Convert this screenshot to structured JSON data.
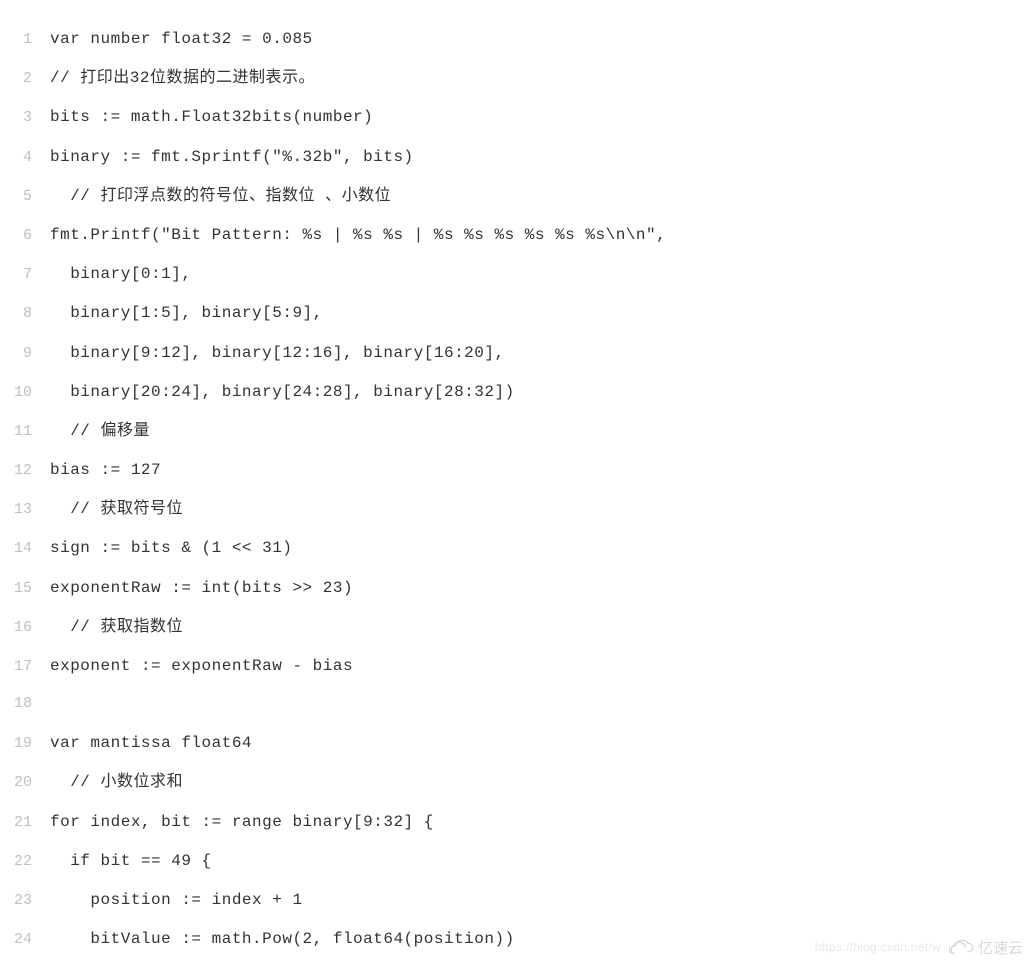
{
  "code": {
    "lines": [
      {
        "num": "1",
        "text": "var number float32 = 0.085"
      },
      {
        "num": "2",
        "text": "// 打印出32位数据的二进制表示。"
      },
      {
        "num": "3",
        "text": "bits := math.Float32bits(number)"
      },
      {
        "num": "4",
        "text": "binary := fmt.Sprintf(\"%.32b\", bits)"
      },
      {
        "num": "5",
        "text": "  // 打印浮点数的符号位、指数位 、小数位"
      },
      {
        "num": "6",
        "text": "fmt.Printf(\"Bit Pattern: %s | %s %s | %s %s %s %s %s %s\\n\\n\","
      },
      {
        "num": "7",
        "text": "  binary[0:1],"
      },
      {
        "num": "8",
        "text": "  binary[1:5], binary[5:9],"
      },
      {
        "num": "9",
        "text": "  binary[9:12], binary[12:16], binary[16:20],"
      },
      {
        "num": "10",
        "text": "  binary[20:24], binary[24:28], binary[28:32])"
      },
      {
        "num": "11",
        "text": "  // 偏移量"
      },
      {
        "num": "12",
        "text": "bias := 127"
      },
      {
        "num": "13",
        "text": "  // 获取符号位"
      },
      {
        "num": "14",
        "text": "sign := bits & (1 << 31)"
      },
      {
        "num": "15",
        "text": "exponentRaw := int(bits >> 23)"
      },
      {
        "num": "16",
        "text": "  // 获取指数位"
      },
      {
        "num": "17",
        "text": "exponent := exponentRaw - bias"
      },
      {
        "num": "18",
        "text": ""
      },
      {
        "num": "19",
        "text": "var mantissa float64"
      },
      {
        "num": "20",
        "text": "  // 小数位求和"
      },
      {
        "num": "21",
        "text": "for index, bit := range binary[9:32] {"
      },
      {
        "num": "22",
        "text": "  if bit == 49 {"
      },
      {
        "num": "23",
        "text": "    position := index + 1"
      },
      {
        "num": "24",
        "text": "    bitValue := math.Pow(2, float64(position))"
      }
    ]
  },
  "watermark": {
    "csdn": "https://blog.csdn.net/w",
    "brand": "亿速云"
  }
}
